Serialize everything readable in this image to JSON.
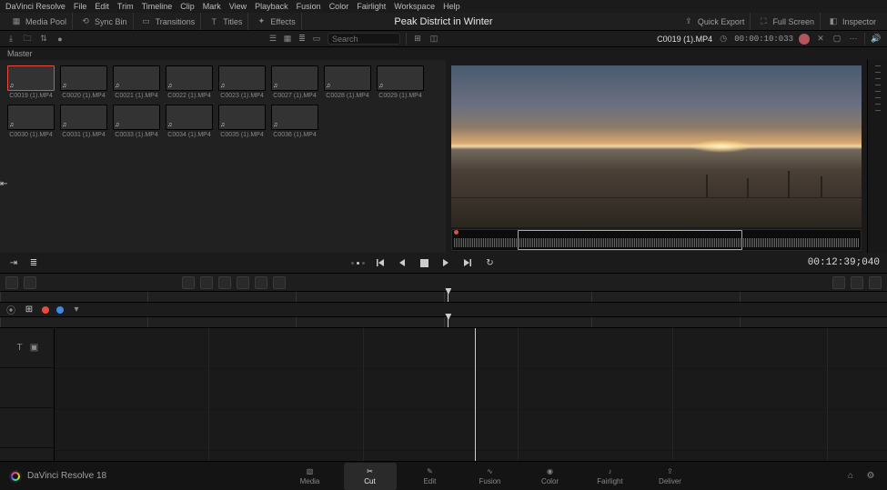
{
  "app_name": "DaVinci Resolve",
  "menus": [
    "DaVinci Resolve",
    "File",
    "Edit",
    "Trim",
    "Timeline",
    "Clip",
    "Mark",
    "View",
    "Playback",
    "Fusion",
    "Color",
    "Fairlight",
    "Workspace",
    "Help"
  ],
  "project_title": "Peak District in Winter",
  "toolstrip": {
    "left_tabs": [
      {
        "icon": "media-pool-icon",
        "label": "Media Pool"
      },
      {
        "icon": "sync-bin-icon",
        "label": "Sync Bin"
      },
      {
        "icon": "transitions-icon",
        "label": "Transitions"
      },
      {
        "icon": "titles-icon",
        "label": "Titles"
      },
      {
        "icon": "effects-icon",
        "label": "Effects"
      }
    ],
    "right_buttons": [
      {
        "icon": "quick-export-icon",
        "label": "Quick Export"
      },
      {
        "icon": "full-screen-icon",
        "label": "Full Screen"
      },
      {
        "icon": "inspector-icon",
        "label": "Inspector"
      }
    ]
  },
  "secbar": {
    "search_placeholder": "Search",
    "clip_name": "C0019 (1).MP4",
    "source_tc": "00:00:10:033"
  },
  "breadcrumb": "Master",
  "clips": [
    {
      "name": "C0019 (1).MP4",
      "art": "sky1",
      "selected": true
    },
    {
      "name": "C0020 (1).MP4",
      "art": "sky2"
    },
    {
      "name": "C0021 (1).MP4",
      "art": "sky2"
    },
    {
      "name": "C0022 (1).MP4",
      "art": "sky3"
    },
    {
      "name": "C0023 (1).MP4",
      "art": "sky3"
    },
    {
      "name": "C0027 (1).MP4",
      "art": "trees"
    },
    {
      "name": "C0028 (1).MP4",
      "art": "trees"
    },
    {
      "name": "C0029 (1).MP4",
      "art": "trees"
    },
    {
      "name": "C0030 (1).MP4",
      "art": "foam"
    },
    {
      "name": "C0031 (1).MP4",
      "art": "foam"
    },
    {
      "name": "C0033 (1).MP4",
      "art": "snow"
    },
    {
      "name": "C0034 (1).MP4",
      "art": "snow"
    },
    {
      "name": "C0035 (1).MP4",
      "art": "snow"
    },
    {
      "name": "C0036 (1).MP4",
      "art": "snow"
    }
  ],
  "transport": {
    "timecode": "00:12:39;040"
  },
  "timeline": {
    "ruler_labels": [
      "",
      "",
      "",
      "",
      "",
      "",
      ""
    ],
    "playhead_pct": 50.5
  },
  "pages": {
    "brand": "DaVinci Resolve 18",
    "tabs": [
      "Media",
      "Cut",
      "Edit",
      "Fusion",
      "Color",
      "Fairlight",
      "Deliver"
    ],
    "active": "Cut"
  }
}
